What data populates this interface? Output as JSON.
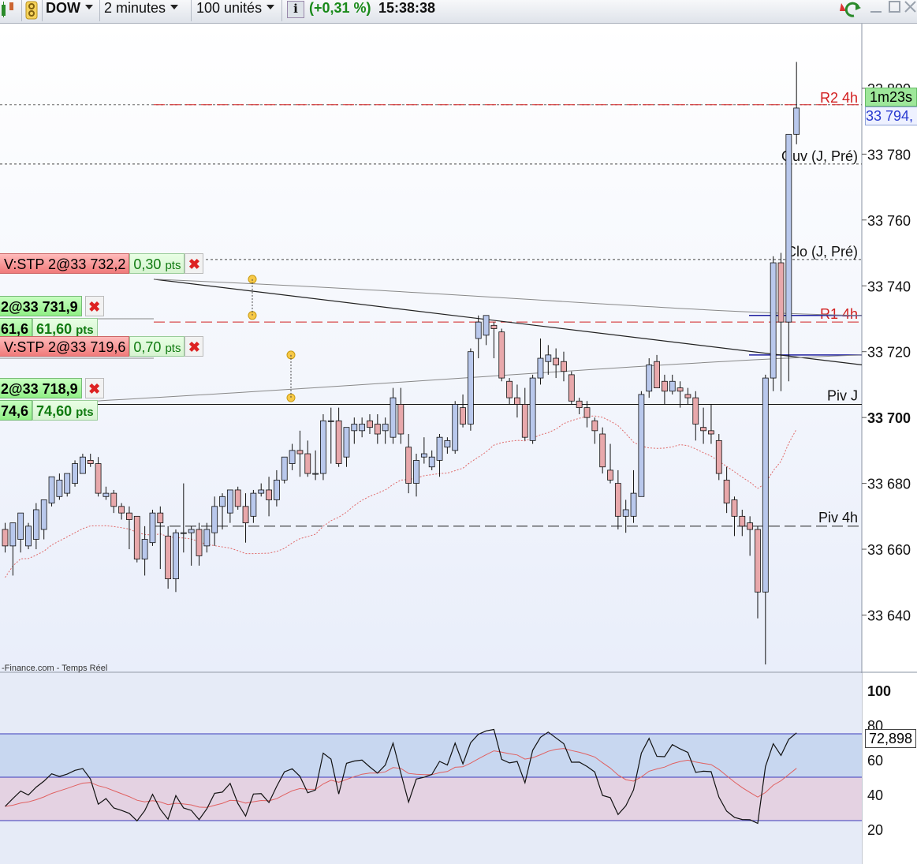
{
  "toolbar": {
    "instrument": "DOW",
    "timeframe": "2 minutes",
    "units": "100 unités",
    "change": "(+0,31 %)",
    "time": "15:38:38",
    "info_icon": "i"
  },
  "colors": {
    "bull": "#b9c8ec",
    "bear": "#e8a8ab",
    "change": "#1a8a1a",
    "resistance": "#d22020",
    "rsi_band": "#c8d7f0",
    "rsi_band_low": "#e4d2e2"
  },
  "price_labels": {
    "timer": "1m23s",
    "last": "33 794,",
    "rsi_value": "72,898"
  },
  "level_labels": {
    "r2": "R2 4h",
    "r1": "R1 4h",
    "ouv": "Ouv (J, Pré)",
    "clo": "Clo (J, Pré)",
    "pivj": "Piv J",
    "piv4h": "Piv 4h"
  },
  "orders": [
    {
      "label": "V:STP 2@33 732,2",
      "pts": "0,30",
      "unit": "pts"
    },
    {
      "label": "2@33 731,9",
      "pts": "61,6",
      "pts2": "61,60",
      "unit": "pts"
    },
    {
      "label": "V:STP 2@33 719,6",
      "pts": "0,70",
      "unit": "pts"
    },
    {
      "label": "2@33 718,9",
      "pts": "74,6",
      "pts2": "74,60",
      "unit": "pts"
    }
  ],
  "close_glyph": "✖",
  "source": "-Finance.com - Temps Réel",
  "chart_data": {
    "type": "candlestick",
    "price_axis": {
      "ticks": [
        "33 640",
        "33 660",
        "33 680",
        "33 700",
        "33 720",
        "33 740",
        "33 760",
        "33 780",
        "33 800"
      ],
      "range": [
        33620,
        33810
      ]
    },
    "levels": [
      {
        "name": "R2 4h",
        "value": 33795
      },
      {
        "name": "Ouv (J, Pré)",
        "value": 33777
      },
      {
        "name": "Clo (J, Pré)",
        "value": 33748
      },
      {
        "name": "R1 4h",
        "value": 33729
      },
      {
        "name": "Piv J",
        "value": 33704
      },
      {
        "name": "Piv 4h",
        "value": 33667
      }
    ],
    "candles": [
      {
        "o": 33666,
        "h": 33668,
        "l": 33659,
        "c": 33661
      },
      {
        "o": 33661,
        "h": 33668,
        "l": 33652,
        "c": 33668
      },
      {
        "o": 33663,
        "h": 33671,
        "l": 33659,
        "c": 33671
      },
      {
        "o": 33661,
        "h": 33668,
        "l": 33660,
        "c": 33667
      },
      {
        "o": 33663,
        "h": 33674,
        "l": 33660,
        "c": 33672
      },
      {
        "o": 33666,
        "h": 33675,
        "l": 33663,
        "c": 33675
      },
      {
        "o": 33674,
        "h": 33682,
        "l": 33673,
        "c": 33682
      },
      {
        "o": 33676,
        "h": 33683,
        "l": 33675,
        "c": 33681
      },
      {
        "o": 33677,
        "h": 33683,
        "l": 33676,
        "c": 33683
      },
      {
        "o": 33680,
        "h": 33687,
        "l": 33679,
        "c": 33686
      },
      {
        "o": 33683,
        "h": 33689,
        "l": 33683,
        "c": 33688
      },
      {
        "o": 33687,
        "h": 33689,
        "l": 33685,
        "c": 33686
      },
      {
        "o": 33686,
        "h": 33688,
        "l": 33676,
        "c": 33677
      },
      {
        "o": 33676,
        "h": 33679,
        "l": 33675,
        "c": 33677
      },
      {
        "o": 33677,
        "h": 33678,
        "l": 33671,
        "c": 33673
      },
      {
        "o": 33673,
        "h": 33674,
        "l": 33669,
        "c": 33671
      },
      {
        "o": 33671,
        "h": 33673,
        "l": 33660,
        "c": 33669
      },
      {
        "o": 33670,
        "h": 33670,
        "l": 33656,
        "c": 33657
      },
      {
        "o": 33657,
        "h": 33667,
        "l": 33652,
        "c": 33663
      },
      {
        "o": 33662,
        "h": 33672,
        "l": 33661,
        "c": 33671
      },
      {
        "o": 33671,
        "h": 33673,
        "l": 33654,
        "c": 33668
      },
      {
        "o": 33664,
        "h": 33667,
        "l": 33648,
        "c": 33651
      },
      {
        "o": 33651,
        "h": 33666,
        "l": 33647,
        "c": 33665
      },
      {
        "o": 33665,
        "h": 33680,
        "l": 33659,
        "c": 33665
      },
      {
        "o": 33665,
        "h": 33667,
        "l": 33655,
        "c": 33666
      },
      {
        "o": 33666,
        "h": 33668,
        "l": 33655,
        "c": 33658
      },
      {
        "o": 33661,
        "h": 33668,
        "l": 33659,
        "c": 33666
      },
      {
        "o": 33665,
        "h": 33676,
        "l": 33661,
        "c": 33673
      },
      {
        "o": 33673,
        "h": 33677,
        "l": 33666,
        "c": 33676
      },
      {
        "o": 33671,
        "h": 33678,
        "l": 33668,
        "c": 33678
      },
      {
        "o": 33678,
        "h": 33679,
        "l": 33672,
        "c": 33673
      },
      {
        "o": 33673,
        "h": 33677,
        "l": 33662,
        "c": 33668
      },
      {
        "o": 33670,
        "h": 33678,
        "l": 33668,
        "c": 33677
      },
      {
        "o": 33677,
        "h": 33680,
        "l": 33676,
        "c": 33678
      },
      {
        "o": 33678,
        "h": 33682,
        "l": 33670,
        "c": 33675
      },
      {
        "o": 33675,
        "h": 33684,
        "l": 33673,
        "c": 33681
      },
      {
        "o": 33681,
        "h": 33688,
        "l": 33680,
        "c": 33688
      },
      {
        "o": 33686,
        "h": 33692,
        "l": 33684,
        "c": 33690
      },
      {
        "o": 33690,
        "h": 33696,
        "l": 33682,
        "c": 33689
      },
      {
        "o": 33689,
        "h": 33693,
        "l": 33682,
        "c": 33683
      },
      {
        "o": 33683,
        "h": 33690,
        "l": 33681,
        "c": 33683
      },
      {
        "o": 33683,
        "h": 33701,
        "l": 33681,
        "c": 33699
      },
      {
        "o": 33699,
        "h": 33703,
        "l": 33686,
        "c": 33699
      },
      {
        "o": 33699,
        "h": 33703,
        "l": 33685,
        "c": 33686
      },
      {
        "o": 33688,
        "h": 33697,
        "l": 33685,
        "c": 33697
      },
      {
        "o": 33696,
        "h": 33700,
        "l": 33692,
        "c": 33698
      },
      {
        "o": 33696,
        "h": 33700,
        "l": 33694,
        "c": 33698
      },
      {
        "o": 33699,
        "h": 33701,
        "l": 33695,
        "c": 33697
      },
      {
        "o": 33698,
        "h": 33701,
        "l": 33692,
        "c": 33695
      },
      {
        "o": 33696,
        "h": 33700,
        "l": 33692,
        "c": 33698
      },
      {
        "o": 33694,
        "h": 33709,
        "l": 33692,
        "c": 33706
      },
      {
        "o": 33704,
        "h": 33709,
        "l": 33692,
        "c": 33695
      },
      {
        "o": 33691,
        "h": 33695,
        "l": 33677,
        "c": 33680
      },
      {
        "o": 33680,
        "h": 33689,
        "l": 33676,
        "c": 33687
      },
      {
        "o": 33688,
        "h": 33694,
        "l": 33686,
        "c": 33689
      },
      {
        "o": 33685,
        "h": 33690,
        "l": 33684,
        "c": 33688
      },
      {
        "o": 33687,
        "h": 33695,
        "l": 33682,
        "c": 33694
      },
      {
        "o": 33691,
        "h": 33694,
        "l": 33689,
        "c": 33693
      },
      {
        "o": 33690,
        "h": 33705,
        "l": 33689,
        "c": 33704
      },
      {
        "o": 33703,
        "h": 33707,
        "l": 33697,
        "c": 33698
      },
      {
        "o": 33698,
        "h": 33721,
        "l": 33696,
        "c": 33720
      },
      {
        "o": 33724,
        "h": 33731,
        "l": 33718,
        "c": 33729
      },
      {
        "o": 33725,
        "h": 33731,
        "l": 33722,
        "c": 33731
      },
      {
        "o": 33728,
        "h": 33729,
        "l": 33718,
        "c": 33727
      },
      {
        "o": 33726,
        "h": 33727,
        "l": 33711,
        "c": 33712
      },
      {
        "o": 33711,
        "h": 33712,
        "l": 33704,
        "c": 33706
      },
      {
        "o": 33706,
        "h": 33710,
        "l": 33700,
        "c": 33704
      },
      {
        "o": 33704,
        "h": 33709,
        "l": 33693,
        "c": 33694
      },
      {
        "o": 33693,
        "h": 33713,
        "l": 33692,
        "c": 33712
      },
      {
        "o": 33712,
        "h": 33724,
        "l": 33710,
        "c": 33718
      },
      {
        "o": 33717,
        "h": 33722,
        "l": 33713,
        "c": 33719
      },
      {
        "o": 33718,
        "h": 33721,
        "l": 33712,
        "c": 33716
      },
      {
        "o": 33717,
        "h": 33720,
        "l": 33711,
        "c": 33714
      },
      {
        "o": 33713,
        "h": 33714,
        "l": 33704,
        "c": 33705
      },
      {
        "o": 33705,
        "h": 33706,
        "l": 33701,
        "c": 33703
      },
      {
        "o": 33703,
        "h": 33705,
        "l": 33697,
        "c": 33700
      },
      {
        "o": 33699,
        "h": 33700,
        "l": 33692,
        "c": 33696
      },
      {
        "o": 33695,
        "h": 33697,
        "l": 33683,
        "c": 33685
      },
      {
        "o": 33684,
        "h": 33692,
        "l": 33680,
        "c": 33681
      },
      {
        "o": 33680,
        "h": 33684,
        "l": 33666,
        "c": 33670
      },
      {
        "o": 33670,
        "h": 33675,
        "l": 33665,
        "c": 33672
      },
      {
        "o": 33670,
        "h": 33684,
        "l": 33668,
        "c": 33677
      },
      {
        "o": 33676,
        "h": 33708,
        "l": 33676,
        "c": 33707
      },
      {
        "o": 33708,
        "h": 33718,
        "l": 33706,
        "c": 33716
      },
      {
        "o": 33717,
        "h": 33719,
        "l": 33709,
        "c": 33709
      },
      {
        "o": 33711,
        "h": 33713,
        "l": 33704,
        "c": 33708
      },
      {
        "o": 33708,
        "h": 33713,
        "l": 33707,
        "c": 33711
      },
      {
        "o": 33709,
        "h": 33711,
        "l": 33703,
        "c": 33708
      },
      {
        "o": 33707,
        "h": 33709,
        "l": 33704,
        "c": 33706
      },
      {
        "o": 33706,
        "h": 33708,
        "l": 33693,
        "c": 33698
      },
      {
        "o": 33697,
        "h": 33703,
        "l": 33692,
        "c": 33696
      },
      {
        "o": 33696,
        "h": 33704,
        "l": 33692,
        "c": 33695
      },
      {
        "o": 33693,
        "h": 33695,
        "l": 33681,
        "c": 33683
      },
      {
        "o": 33681,
        "h": 33685,
        "l": 33671,
        "c": 33674
      },
      {
        "o": 33675,
        "h": 33676,
        "l": 33664,
        "c": 33670
      },
      {
        "o": 33670,
        "h": 33672,
        "l": 33664,
        "c": 33667
      },
      {
        "o": 33668,
        "h": 33670,
        "l": 33658,
        "c": 33666
      },
      {
        "o": 33666,
        "h": 33667,
        "l": 33639,
        "c": 33647
      },
      {
        "o": 33647,
        "h": 33713,
        "l": 33625,
        "c": 33712
      },
      {
        "o": 33712,
        "h": 33749,
        "l": 33708,
        "c": 33747
      },
      {
        "o": 33747,
        "h": 33750,
        "l": 33708,
        "c": 33729
      },
      {
        "o": 33729,
        "h": 33769,
        "l": 33711,
        "c": 33786
      },
      {
        "o": 33786,
        "h": 33808,
        "l": 33783,
        "c": 33794
      }
    ],
    "rsi": {
      "axis": [
        "100",
        "80",
        "60",
        "40",
        "20"
      ],
      "bands": [
        75,
        50,
        25
      ],
      "value": 72.898
    }
  }
}
